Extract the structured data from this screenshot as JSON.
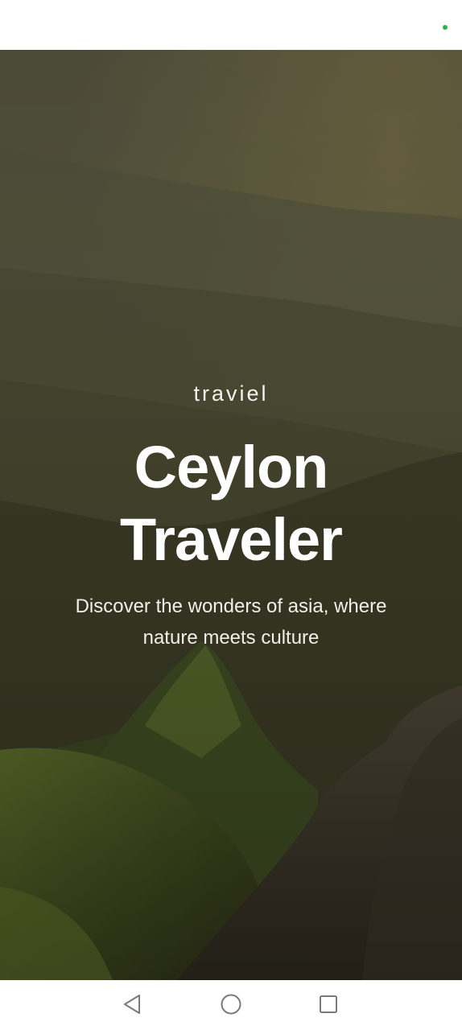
{
  "status_bar": {
    "indicator_color": "#2db14f"
  },
  "hero": {
    "brand": "traviel",
    "title_line1": "Ceylon",
    "title_line2": "Traveler",
    "subtitle": "Discover the wonders of asia, where nature meets culture"
  },
  "nav_bar": {
    "back_icon": "triangle-back-icon",
    "home_icon": "circle-home-icon",
    "recents_icon": "square-recents-icon"
  }
}
